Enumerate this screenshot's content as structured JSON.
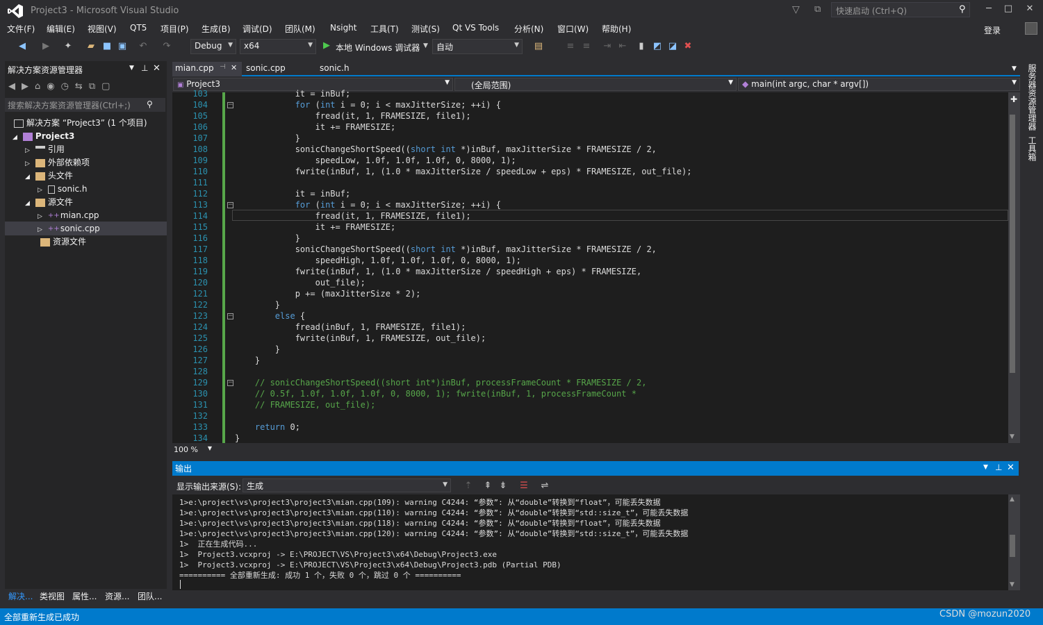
{
  "titlebar": {
    "title": "Project3 - Microsoft Visual Studio",
    "quick_launch": "快速启动 (Ctrl+Q)",
    "login": "登录"
  },
  "menu": [
    "文件(F)",
    "编辑(E)",
    "视图(V)",
    "QT5",
    "项目(P)",
    "生成(B)",
    "调试(D)",
    "团队(M)",
    "Nsight",
    "工具(T)",
    "测试(S)",
    "Qt VS Tools",
    "分析(N)",
    "窗口(W)",
    "帮助(H)"
  ],
  "toolbar": {
    "config": "Debug",
    "platform": "x64",
    "run_label": "本地 Windows 调试器",
    "run_mode": "自动"
  },
  "solution": {
    "header": "解决方案资源管理器",
    "search_placeholder": "搜索解决方案资源管理器(Ctrl+;)",
    "items": [
      {
        "label": "解决方案 “Project3” (1 个项目)"
      },
      {
        "label": "Project3"
      },
      {
        "label": "引用"
      },
      {
        "label": "外部依赖项"
      },
      {
        "label": "头文件"
      },
      {
        "label": "sonic.h"
      },
      {
        "label": "源文件"
      },
      {
        "label": "mian.cpp"
      },
      {
        "label": "sonic.cpp"
      },
      {
        "label": "资源文件"
      }
    ],
    "bottom_tabs": [
      "解决...",
      "类视图",
      "属性...",
      "资源...",
      "团队..."
    ]
  },
  "editor": {
    "tabs": [
      "mian.cpp",
      "sonic.cpp",
      "sonic.h"
    ],
    "nav_project": "Project3",
    "nav_scope": "(全局范围)",
    "nav_member": "main(int argc, char * argv[])",
    "zoom": "100 %",
    "lines": [
      {
        "n": "103",
        "t": "            it = inBuf;"
      },
      {
        "n": "104",
        "t": "            for (int i = 0; i < maxJitterSize; ++i) {"
      },
      {
        "n": "105",
        "t": "                fread(it, 1, FRAMESIZE, file1);"
      },
      {
        "n": "106",
        "t": "                it += FRAMESIZE;"
      },
      {
        "n": "107",
        "t": "            }"
      },
      {
        "n": "108",
        "t": "            sonicChangeShortSpeed((short int *)inBuf, maxJitterSize * FRAMESIZE / 2,"
      },
      {
        "n": "109",
        "t": "                speedLow, 1.0f, 1.0f, 1.0f, 0, 8000, 1);"
      },
      {
        "n": "110",
        "t": "            fwrite(inBuf, 1, (1.0 * maxJitterSize / speedLow + eps) * FRAMESIZE, out_file);"
      },
      {
        "n": "111",
        "t": ""
      },
      {
        "n": "112",
        "t": "            it = inBuf;"
      },
      {
        "n": "113",
        "t": "            for (int i = 0; i < maxJitterSize; ++i) {"
      },
      {
        "n": "114",
        "t": "                fread(it, 1, FRAMESIZE, file1);"
      },
      {
        "n": "115",
        "t": "                it += FRAMESIZE;"
      },
      {
        "n": "116",
        "t": "            }"
      },
      {
        "n": "117",
        "t": "            sonicChangeShortSpeed((short int *)inBuf, maxJitterSize * FRAMESIZE / 2,"
      },
      {
        "n": "118",
        "t": "                speedHigh, 1.0f, 1.0f, 1.0f, 0, 8000, 1);"
      },
      {
        "n": "119",
        "t": "            fwrite(inBuf, 1, (1.0 * maxJitterSize / speedHigh + eps) * FRAMESIZE,"
      },
      {
        "n": "120",
        "t": "                out_file);"
      },
      {
        "n": "121",
        "t": "            p += (maxJitterSize * 2);"
      },
      {
        "n": "122",
        "t": "        }"
      },
      {
        "n": "123",
        "t": "        else {"
      },
      {
        "n": "124",
        "t": "            fread(inBuf, 1, FRAMESIZE, file1);"
      },
      {
        "n": "125",
        "t": "            fwrite(inBuf, 1, FRAMESIZE, out_file);"
      },
      {
        "n": "126",
        "t": "        }"
      },
      {
        "n": "127",
        "t": "    }"
      },
      {
        "n": "128",
        "t": ""
      },
      {
        "n": "129",
        "t": "    // sonicChangeShortSpeed((short int*)inBuf, processFrameCount * FRAMESIZE / 2,"
      },
      {
        "n": "130",
        "t": "    // 0.5f, 1.0f, 1.0f, 1.0f, 0, 8000, 1); fwrite(inBuf, 1, processFrameCount *"
      },
      {
        "n": "131",
        "t": "    // FRAMESIZE, out_file);"
      },
      {
        "n": "132",
        "t": ""
      },
      {
        "n": "133",
        "t": "    return 0;"
      },
      {
        "n": "134",
        "t": "}"
      }
    ]
  },
  "output": {
    "title": "输出",
    "source_label": "显示输出来源(S):",
    "source_value": "生成",
    "lines": [
      "1>e:\\project\\vs\\project3\\project3\\mian.cpp(109): warning C4244: “参数”: 从“double”转换到“float”，可能丢失数据",
      "1>e:\\project\\vs\\project3\\project3\\mian.cpp(110): warning C4244: “参数”: 从“double”转换到“std::size_t”，可能丢失数据",
      "1>e:\\project\\vs\\project3\\project3\\mian.cpp(118): warning C4244: “参数”: 从“double”转换到“float”，可能丢失数据",
      "1>e:\\project\\vs\\project3\\project3\\mian.cpp(120): warning C4244: “参数”: 从“double”转换到“std::size_t”，可能丢失数据",
      "1>  正在生成代码...",
      "1>  Project3.vcxproj -> E:\\PROJECT\\VS\\Project3\\x64\\Debug\\Project3.exe",
      "1>  Project3.vcxproj -> E:\\PROJECT\\VS\\Project3\\x64\\Debug\\Project3.pdb (Partial PDB)",
      "========== 全部重新生成: 成功 1 个，失败 0 个，跳过 0 个 =========="
    ]
  },
  "status": {
    "text": "全部重新生成已成功",
    "watermark": "CSDN @mozun2020"
  },
  "right_tabs": [
    "服务器资源管理器",
    "工具箱"
  ],
  "colors": {
    "accent": "#007acc",
    "keyword": "#569cd6",
    "comment": "#57a64a",
    "linenumber": "#2b91af"
  }
}
